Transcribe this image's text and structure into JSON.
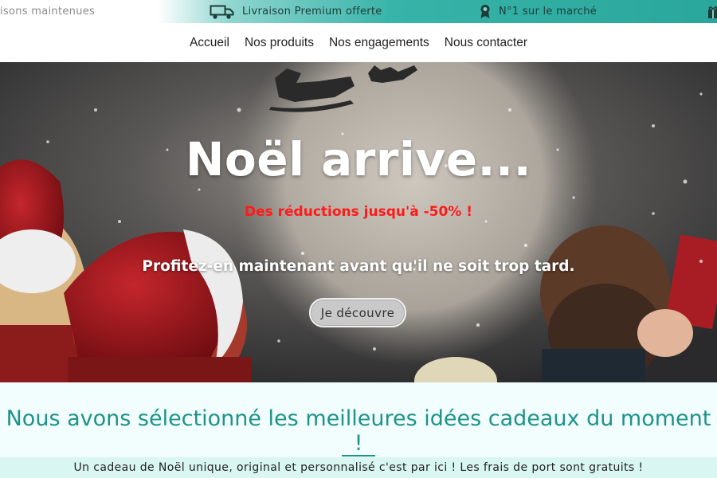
{
  "topbar": {
    "item_partial": "isons maintenues",
    "item_delivery": "Livraison Premium offerte",
    "item_rank": "N°1 sur le marché",
    "icons": [
      "truck-icon",
      "award-ribbon-icon",
      "gift-icon"
    ]
  },
  "nav": {
    "links": [
      "Accueil",
      "Nos produits",
      "Nos engagements",
      "Nous contacter"
    ]
  },
  "hero": {
    "title": "Noël arrive...",
    "promo": "Des réductions jusqu'à -50% !",
    "subtitle": "Profitez-en maintenant avant qu'il ne soit trop tard.",
    "cta": "Je découvre"
  },
  "selection": {
    "title": "Nous avons sélectionné les meilleures idées cadeaux du moment !",
    "tagline": "Un cadeau de Noël unique, original et personnalisé c'est par ici ! Les frais de port sont gratuits !"
  },
  "colors": {
    "accent": "#1d938a",
    "promo_red": "#ff1a1a",
    "section_bg": "#f2fefd"
  }
}
